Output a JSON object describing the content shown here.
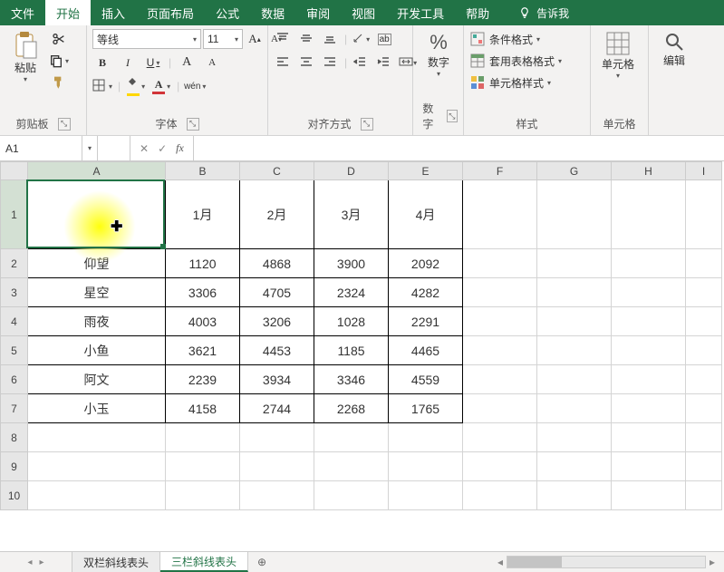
{
  "menu": {
    "file": "文件",
    "home": "开始",
    "insert": "插入",
    "layout": "页面布局",
    "formulas": "公式",
    "data": "数据",
    "review": "审阅",
    "view": "视图",
    "dev": "开发工具",
    "help": "帮助",
    "tellme": "告诉我"
  },
  "ribbon": {
    "clipboard": {
      "paste": "粘贴",
      "label": "剪贴板"
    },
    "font": {
      "name": "等线",
      "size": "11",
      "label": "字体",
      "bold": "B",
      "italic": "I",
      "underline": "U",
      "fontA1": "A",
      "fontA2": "A",
      "wen": "wén"
    },
    "align": {
      "label": "对齐方式",
      "abc": "ab"
    },
    "number": {
      "pct": "%",
      "label": "数字"
    },
    "styles": {
      "cond": "条件格式",
      "table": "套用表格格式",
      "cell": "单元格样式",
      "label": "样式"
    },
    "cells": {
      "label": "单元格"
    },
    "editing": {
      "label": "编辑"
    }
  },
  "fx": {
    "namebox": "A1",
    "cancel": "✕",
    "enter": "✓",
    "fx": "fx"
  },
  "grid": {
    "cols": [
      "A",
      "B",
      "C",
      "D",
      "E",
      "F",
      "G",
      "H",
      "I"
    ],
    "rows": [
      "1",
      "2",
      "3",
      "4",
      "5",
      "6",
      "7",
      "8",
      "9",
      "10"
    ],
    "headers": [
      "",
      "1月",
      "2月",
      "3月",
      "4月"
    ],
    "data": [
      [
        "仰望",
        "1120",
        "4868",
        "3900",
        "2092"
      ],
      [
        "星空",
        "3306",
        "4705",
        "2324",
        "4282"
      ],
      [
        "雨夜",
        "4003",
        "3206",
        "1028",
        "2291"
      ],
      [
        "小鱼",
        "3621",
        "4453",
        "1185",
        "4465"
      ],
      [
        "阿文",
        "2239",
        "3934",
        "3346",
        "4559"
      ],
      [
        "小玉",
        "4158",
        "2744",
        "2268",
        "1765"
      ]
    ]
  },
  "sheets": {
    "tab1": "双栏斜线表头",
    "tab2": "三栏斜线表头",
    "add": "⊕"
  },
  "icons": {
    "cut": "scissors",
    "copy": "copy",
    "brush": "format-painter",
    "triangle_down": "▾",
    "triangle_right": "▸",
    "triangle_left": "◂"
  }
}
